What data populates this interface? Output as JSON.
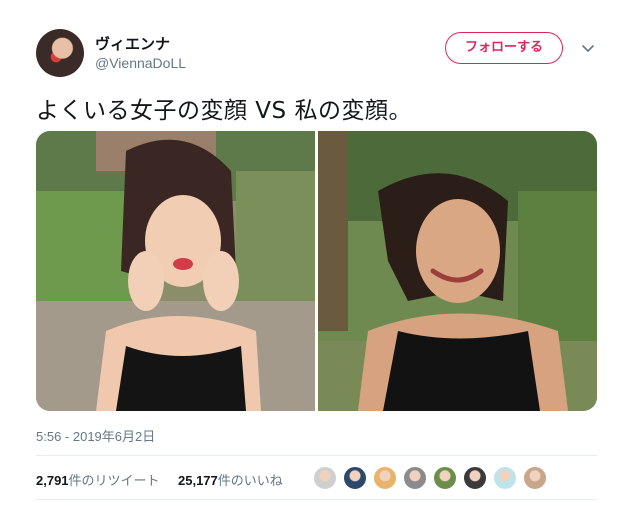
{
  "user": {
    "display_name": "ヴィエンナ",
    "handle": "@ViennaDoLL",
    "avatar_icon": "user-avatar"
  },
  "follow_button": {
    "label": "フォローする",
    "color": "#e0245e"
  },
  "menu": {
    "icon": "chevron-down-icon"
  },
  "tweet": {
    "text": "よくいる女子の変顔 VS 私の変顔。",
    "timestamp": "5:56 - 2019年6月2日",
    "media": [
      {
        "description": "photo-left-icon"
      },
      {
        "description": "photo-right-icon"
      }
    ]
  },
  "stats": {
    "retweets": {
      "count": "2,791",
      "label": "件のリツイート"
    },
    "likes": {
      "count": "25,177",
      "label": "件のいいね"
    }
  },
  "likers": [
    {
      "icon": "liker-avatar-1",
      "color": "#cfcfcf"
    },
    {
      "icon": "liker-avatar-2",
      "color": "#2b4a6b"
    },
    {
      "icon": "liker-avatar-3",
      "color": "#e8b36a"
    },
    {
      "icon": "liker-avatar-4",
      "color": "#8b8b8b"
    },
    {
      "icon": "liker-avatar-5",
      "color": "#6b8f4a"
    },
    {
      "icon": "liker-avatar-6",
      "color": "#3a3a3a"
    },
    {
      "icon": "liker-avatar-7",
      "color": "#bfe3ea"
    },
    {
      "icon": "liker-avatar-8",
      "color": "#c9a58a"
    }
  ],
  "colors": {
    "muted": "#657786",
    "text": "#14171a",
    "divider": "#e6ecf0"
  }
}
